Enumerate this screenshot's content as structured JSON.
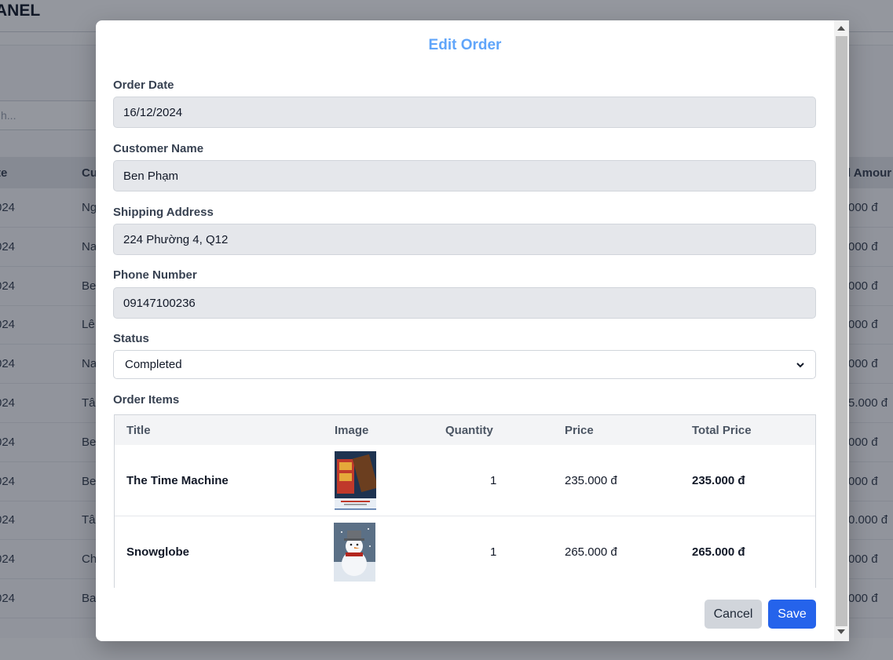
{
  "background": {
    "panel_title": "ANEL",
    "search_placeholder": "h...",
    "headers": {
      "col1": "te",
      "col2": "Cu",
      "col_last": "l Amour"
    },
    "rows": [
      {
        "date": "024",
        "name": "Ng",
        "amount": "000 đ"
      },
      {
        "date": "024",
        "name": "Na",
        "amount": "000 đ"
      },
      {
        "date": "024",
        "name": "Be",
        "amount": "000 đ"
      },
      {
        "date": "024",
        "name": "Lê",
        "amount": "000 đ"
      },
      {
        "date": "024",
        "name": "Na",
        "amount": "000 đ"
      },
      {
        "date": "024",
        "name": "Tâ",
        "amount": "5.000 đ"
      },
      {
        "date": "024",
        "name": "Be",
        "amount": "000 đ"
      },
      {
        "date": "024",
        "name": "Be",
        "amount": "000 đ"
      },
      {
        "date": "024",
        "name": "Tâ",
        "amount": "0.000 đ"
      },
      {
        "date": "024",
        "name": "Ch",
        "amount": "000 đ"
      },
      {
        "date": "024",
        "name": "Ba",
        "amount": "000 đ"
      }
    ]
  },
  "modal": {
    "title": "Edit Order",
    "order_date": {
      "label": "Order Date",
      "value": "16/12/2024"
    },
    "customer_name": {
      "label": "Customer Name",
      "value": "Ben Phạm"
    },
    "shipping_address": {
      "label": "Shipping Address",
      "value": "224 Phường 4, Q12"
    },
    "phone_number": {
      "label": "Phone Number",
      "value": "09147100236"
    },
    "status": {
      "label": "Status",
      "value": "Completed"
    },
    "order_items": {
      "label": "Order Items",
      "columns": [
        "Title",
        "Image",
        "Quantity",
        "Price",
        "Total Price"
      ],
      "rows": [
        {
          "title": "The Time Machine",
          "image": "book-cover-image",
          "quantity": "1",
          "price": "235.000 đ",
          "total": "235.000 đ"
        },
        {
          "title": "Snowglobe",
          "image": "snowman-image",
          "quantity": "1",
          "price": "265.000 đ",
          "total": "265.000 đ"
        }
      ]
    },
    "cancel_label": "Cancel",
    "save_label": "Save"
  },
  "colors": {
    "title_accent": "#60a5fa",
    "save_button": "#2563eb",
    "cancel_button": "#d1d5db"
  }
}
